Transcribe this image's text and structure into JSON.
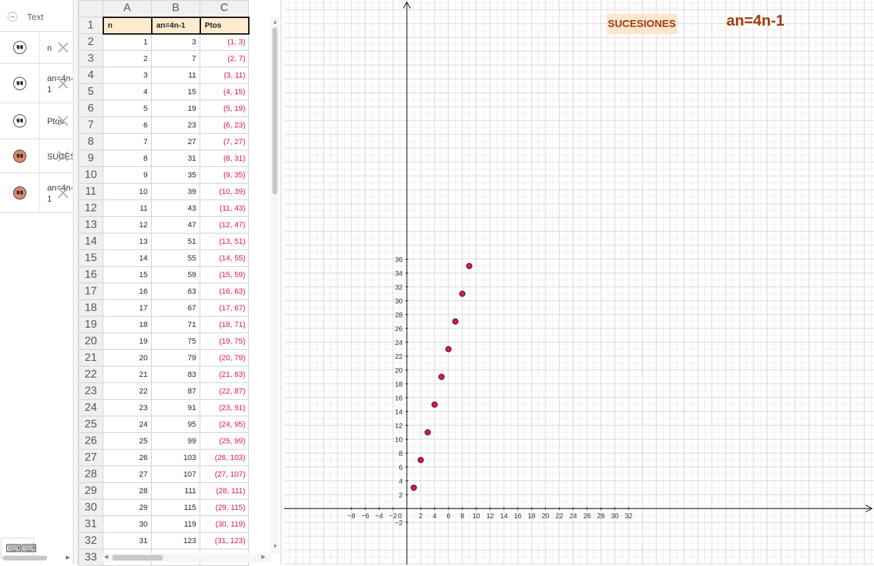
{
  "algebra": {
    "header_label": "Text",
    "items": [
      {
        "text": "n",
        "active": false
      },
      {
        "text": "an=4n-\n1",
        "active": false
      },
      {
        "text": "Ptos",
        "active": false
      },
      {
        "text": "SUCESIONES",
        "active": true
      },
      {
        "text": "an=4n-\n1",
        "active": true
      }
    ]
  },
  "spreadsheet": {
    "columns": [
      "A",
      "B",
      "C"
    ],
    "header_row": {
      "row": "1",
      "a": "n",
      "b": "an=4n-1",
      "c": "Ptos"
    },
    "rows": [
      {
        "row": "2",
        "a": "1",
        "b": "3",
        "c": "(1, 3)"
      },
      {
        "row": "3",
        "a": "2",
        "b": "7",
        "c": "(2, 7)"
      },
      {
        "row": "4",
        "a": "3",
        "b": "11",
        "c": "(3, 11)"
      },
      {
        "row": "5",
        "a": "4",
        "b": "15",
        "c": "(4, 15)"
      },
      {
        "row": "6",
        "a": "5",
        "b": "19",
        "c": "(5, 19)"
      },
      {
        "row": "7",
        "a": "6",
        "b": "23",
        "c": "(6, 23)"
      },
      {
        "row": "8",
        "a": "7",
        "b": "27",
        "c": "(7, 27)"
      },
      {
        "row": "9",
        "a": "8",
        "b": "31",
        "c": "(8, 31)"
      },
      {
        "row": "10",
        "a": "9",
        "b": "35",
        "c": "(9, 35)"
      },
      {
        "row": "11",
        "a": "10",
        "b": "39",
        "c": "(10, 39)"
      },
      {
        "row": "12",
        "a": "11",
        "b": "43",
        "c": "(11, 43)"
      },
      {
        "row": "13",
        "a": "12",
        "b": "47",
        "c": "(12, 47)"
      },
      {
        "row": "14",
        "a": "13",
        "b": "51",
        "c": "(13, 51)"
      },
      {
        "row": "15",
        "a": "14",
        "b": "55",
        "c": "(14, 55)"
      },
      {
        "row": "16",
        "a": "15",
        "b": "59",
        "c": "(15, 59)"
      },
      {
        "row": "17",
        "a": "16",
        "b": "63",
        "c": "(16, 63)"
      },
      {
        "row": "18",
        "a": "17",
        "b": "67",
        "c": "(17, 67)"
      },
      {
        "row": "19",
        "a": "18",
        "b": "71",
        "c": "(18, 71)"
      },
      {
        "row": "20",
        "a": "19",
        "b": "75",
        "c": "(19, 75)"
      },
      {
        "row": "21",
        "a": "20",
        "b": "79",
        "c": "(20, 79)"
      },
      {
        "row": "22",
        "a": "21",
        "b": "83",
        "c": "(21, 83)"
      },
      {
        "row": "23",
        "a": "22",
        "b": "87",
        "c": "(22, 87)"
      },
      {
        "row": "24",
        "a": "23",
        "b": "91",
        "c": "(23, 91)"
      },
      {
        "row": "25",
        "a": "24",
        "b": "95",
        "c": "(24, 95)"
      },
      {
        "row": "26",
        "a": "25",
        "b": "99",
        "c": "(25, 99)"
      },
      {
        "row": "27",
        "a": "26",
        "b": "103",
        "c": "(26, 103)"
      },
      {
        "row": "28",
        "a": "27",
        "b": "107",
        "c": "(27, 107)"
      },
      {
        "row": "29",
        "a": "28",
        "b": "111",
        "c": "(28, 111)"
      },
      {
        "row": "30",
        "a": "29",
        "b": "115",
        "c": "(29, 115)"
      },
      {
        "row": "31",
        "a": "30",
        "b": "119",
        "c": "(30, 119)"
      },
      {
        "row": "32",
        "a": "31",
        "b": "123",
        "c": "(31, 123)"
      },
      {
        "row": "33",
        "a": "",
        "b": "",
        "c": ""
      }
    ]
  },
  "graphics": {
    "title": "SUCESIONES",
    "formula": "an=4n-1",
    "colors": {
      "point": "#e8143a",
      "title": "#a33a0c",
      "title_bg": "#fce6cf"
    }
  },
  "chart_data": {
    "type": "scatter",
    "title": "",
    "xlabel": "",
    "ylabel": "",
    "x_ticks": [
      -8,
      -6,
      -4,
      -2,
      0,
      2,
      4,
      6,
      8,
      10,
      12,
      14,
      16,
      18,
      20,
      22,
      24,
      26,
      28,
      30,
      32
    ],
    "y_ticks": [
      -2,
      2,
      4,
      6,
      8,
      10,
      12,
      14,
      16,
      18,
      20,
      22,
      24,
      26,
      28,
      30,
      32,
      34,
      36
    ],
    "xlim": [
      -8.9,
      33.6
    ],
    "ylim": [
      -3.4,
      36.7
    ],
    "grid": true,
    "series": [
      {
        "x": [
          1,
          2,
          3,
          4,
          5,
          6,
          7,
          8,
          9
        ],
        "y": [
          3,
          7,
          11,
          15,
          19,
          23,
          27,
          31,
          35
        ]
      }
    ]
  }
}
